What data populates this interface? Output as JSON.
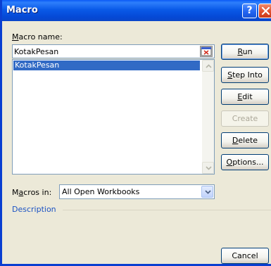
{
  "window": {
    "title": "Macro",
    "help_label": "?"
  },
  "macro_name": {
    "label": "Macro name:",
    "label_accel": "M",
    "label_rest": "acro name:",
    "value": "KotakPesan"
  },
  "macro_list": {
    "items": [
      "KotakPesan"
    ],
    "selected": "KotakPesan"
  },
  "buttons": {
    "run": {
      "accel": "R",
      "rest": "un"
    },
    "step_into": {
      "accel": "S",
      "rest": "tep Into"
    },
    "edit": {
      "accel": "E",
      "rest": "dit"
    },
    "create": {
      "label": "Create"
    },
    "delete": {
      "accel": "D",
      "rest": "elete"
    },
    "options": {
      "accel": "O",
      "rest": "ptions..."
    },
    "cancel": {
      "label": "Cancel"
    }
  },
  "macros_in": {
    "label_accel": "a",
    "label_pre": "M",
    "label_rest": "cros in:",
    "value": "All Open Workbooks"
  },
  "description": {
    "label": "Description"
  }
}
